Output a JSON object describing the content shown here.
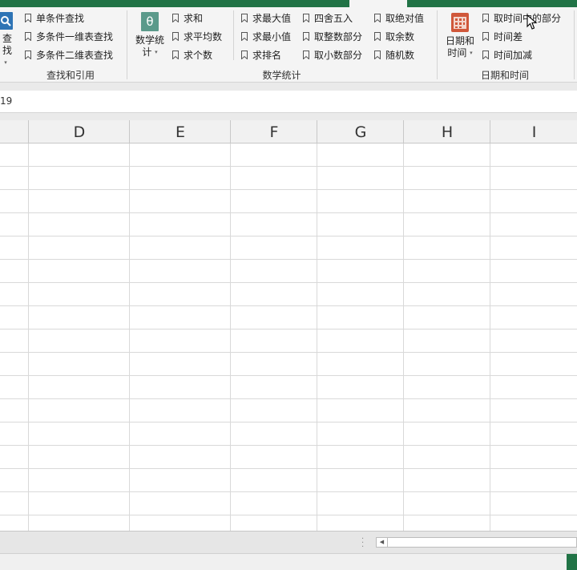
{
  "ribbon": {
    "lookup": {
      "big_button_label": "查找",
      "items": [
        "单条件查找",
        "多条件一维表查找",
        "多条件二维表查找"
      ],
      "group_label": "查找和引用"
    },
    "math": {
      "big_button_label_line1": "数学统",
      "big_button_label_line2": "计",
      "big_icon_glyph": "θ",
      "col1": [
        "求和",
        "求平均数",
        "求个数"
      ],
      "col2": [
        "求最大值",
        "求最小值",
        "求排名"
      ],
      "col3": [
        "四舍五入",
        "取整数部分",
        "取小数部分"
      ],
      "col4": [
        "取绝对值",
        "取余数",
        "随机数"
      ],
      "group_label": "数学统计"
    },
    "datetime": {
      "big_button_label_line1": "日期和",
      "big_button_label_line2": "时间",
      "items": [
        "取时间中的部分",
        "时间差",
        "时间加减"
      ],
      "group_label": "日期和时间"
    },
    "caret": "▾"
  },
  "formula_bar": {
    "name_box_fragment": "19"
  },
  "columns": [
    "D",
    "E",
    "F",
    "G",
    "H",
    "I"
  ],
  "colors": {
    "title_green": "#217346",
    "bookmark": "#555555",
    "lookup_icon": "#2e74b5",
    "math_icon": "#5b9a8b",
    "date_icon": "#d0573a"
  },
  "icons": {
    "lookup": "search-icon",
    "math": "theta-icon",
    "datetime": "calendar-icon",
    "item": "bookmark-icon",
    "pointer": "mouse-pointer-icon"
  }
}
